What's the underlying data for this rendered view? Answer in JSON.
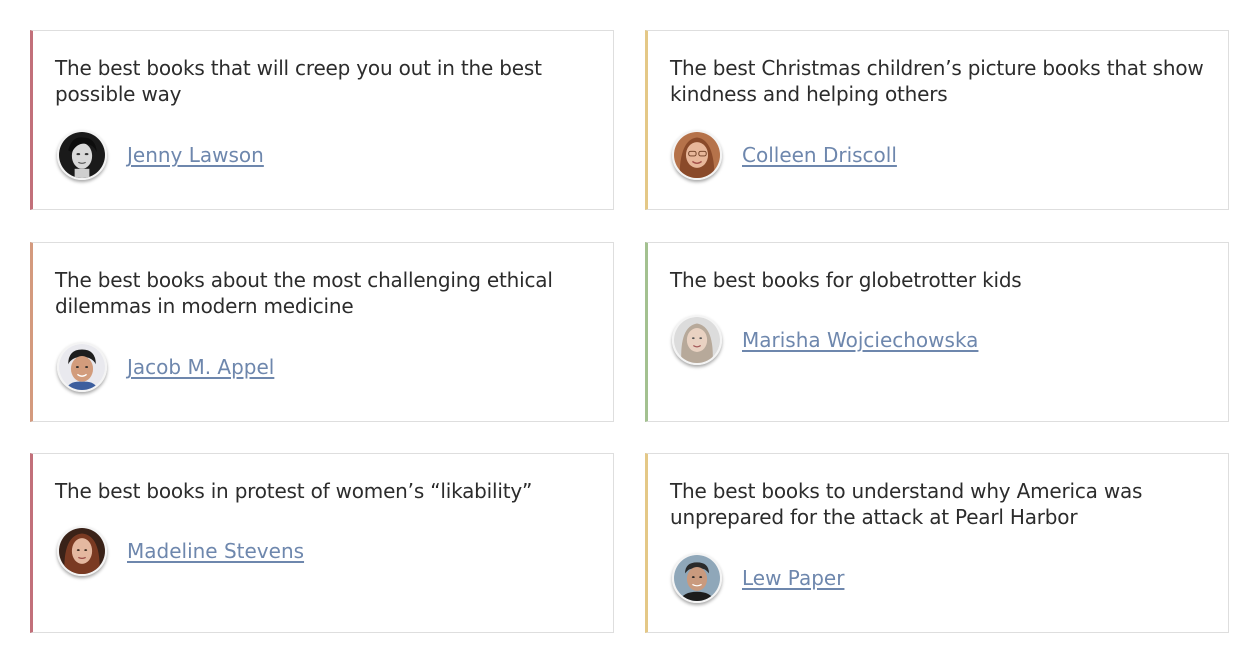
{
  "cards": [
    {
      "title": "The best books that will creep you out in the best possible way",
      "author": "Jenny Lawson",
      "accent": "#c2707a",
      "avatar_icon": "author-photo-jenny-lawson"
    },
    {
      "title": "The best Christmas children’s picture books that show kindness and helping others",
      "author": "Colleen Driscoll",
      "accent": "#e4c887",
      "avatar_icon": "author-photo-colleen-driscoll"
    },
    {
      "title": "The best books about the most challenging ethical dilemmas in modern medicine",
      "author": "Jacob M. Appel",
      "accent": "#d49a7e",
      "avatar_icon": "author-photo-jacob-appel"
    },
    {
      "title": "The best books for globetrotter kids",
      "author": "Marisha Wojciechowska",
      "accent": "#a3c190",
      "avatar_icon": "author-photo-marisha-wojciechowska"
    },
    {
      "title": "The best books in protest of women’s “likability”",
      "author": "Madeline Stevens",
      "accent": "#c2707a",
      "avatar_icon": "author-photo-madeline-stevens"
    },
    {
      "title": "The best books to understand why America was unprepared for the attack at Pearl Harbor",
      "author": "Lew Paper",
      "accent": "#e4c887",
      "avatar_icon": "author-photo-lew-paper"
    }
  ]
}
